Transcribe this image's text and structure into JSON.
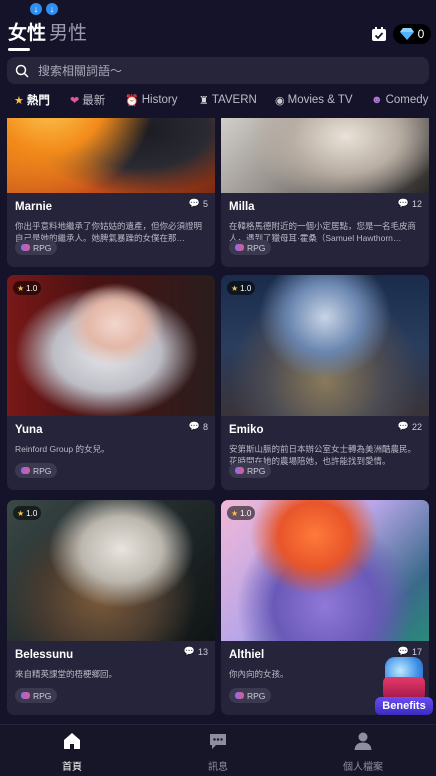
{
  "status_bar": {
    "icons": [
      "download-icon",
      "download-icon"
    ]
  },
  "header": {
    "gender_tabs": [
      {
        "label": "女性",
        "active": true
      },
      {
        "label": "男性",
        "active": false
      }
    ],
    "diamond_count": "0"
  },
  "search": {
    "placeholder": "搜索相關詞語～"
  },
  "categories": [
    {
      "label": "熱門",
      "icon": "star-icon",
      "active": true
    },
    {
      "label": "最新",
      "icon": "heart-icon",
      "active": false
    },
    {
      "label": "History",
      "icon": "clock-icon",
      "active": false
    },
    {
      "label": "TAVERN",
      "icon": "tavern-icon",
      "active": false
    },
    {
      "label": "Movies & TV",
      "icon": "film-icon",
      "active": false
    },
    {
      "label": "Comedy",
      "icon": "comedy-icon",
      "active": false
    }
  ],
  "cards": [
    {
      "name": "Marnie",
      "comments": "5",
      "rating": "",
      "description": "你出乎意料地繼承了你姑姑的遺產，但你必須證明自己是她的繼承人。她脾氣暴躁的女僕在那…",
      "tag": "RPG"
    },
    {
      "name": "Milla",
      "comments": "12",
      "rating": "",
      "description": "在韓格馬德附近的一個小定居點，您是一名毛皮商人，遇到了獵母耳·霍桑（Samuel Hawthorn…",
      "tag": "RPG"
    },
    {
      "name": "Yuna",
      "comments": "8",
      "rating": "1.0",
      "description": "Reinford Group 的女兒。",
      "tag": "RPG"
    },
    {
      "name": "Emiko",
      "comments": "22",
      "rating": "1.0",
      "description": "安第斯山脈的前日本辦公室女士轉為美洲酷農民。花時間在她的農場陪她，也許能找到愛情。",
      "tag": "RPG"
    },
    {
      "name": "Belessunu",
      "comments": "13",
      "rating": "1.0",
      "description": "來自精英課堂的梧梗鄉回。",
      "tag": "RPG"
    },
    {
      "name": "Althiel",
      "comments": "17",
      "rating": "1.0",
      "description": "你內向的女孩。",
      "tag": "RPG"
    }
  ],
  "benefits_label": "Benefits",
  "bottom_nav": [
    {
      "label": "首頁",
      "icon": "home-icon",
      "active": true
    },
    {
      "label": "訊息",
      "icon": "chat-icon",
      "active": false
    },
    {
      "label": "個人檔案",
      "icon": "profile-icon",
      "active": false
    }
  ],
  "colors": {
    "background": "#14132a",
    "card": "#25243a",
    "accent": "#2f8ff0"
  }
}
